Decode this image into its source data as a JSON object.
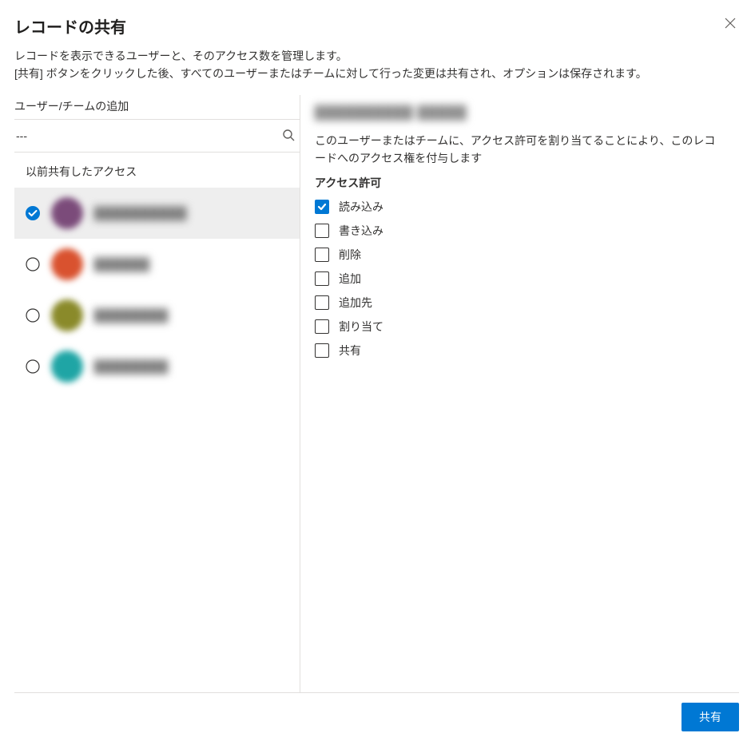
{
  "dialog": {
    "title": "レコードの共有",
    "desc_line1": "レコードを表示できるユーザーと、そのアクセス数を管理します。",
    "desc_line2": "[共有] ボタンをクリックした後、すべてのユーザーまたはチームに対して行った変更は共有され、オプションは保存されます。"
  },
  "left": {
    "add_label": "ユーザー/チームの追加",
    "search_value": "---",
    "list_heading": "以前共有したアクセス",
    "users": [
      {
        "name": "██████████",
        "selected": true,
        "avatar_class": "av1"
      },
      {
        "name": "██████",
        "selected": false,
        "avatar_class": "av2"
      },
      {
        "name": "████████",
        "selected": false,
        "avatar_class": "av3"
      },
      {
        "name": "████████",
        "selected": false,
        "avatar_class": "av4"
      }
    ]
  },
  "right": {
    "selected_user": "██████████ █████",
    "desc": "このユーザーまたはチームに、アクセス許可を割り当てることにより、このレコードへのアクセス権を付与します",
    "perm_heading": "アクセス許可",
    "permissions": [
      {
        "label": "読み込み",
        "checked": true
      },
      {
        "label": "書き込み",
        "checked": false
      },
      {
        "label": "削除",
        "checked": false
      },
      {
        "label": "追加",
        "checked": false
      },
      {
        "label": "追加先",
        "checked": false
      },
      {
        "label": "割り当て",
        "checked": false
      },
      {
        "label": "共有",
        "checked": false
      }
    ]
  },
  "footer": {
    "share_label": "共有"
  }
}
